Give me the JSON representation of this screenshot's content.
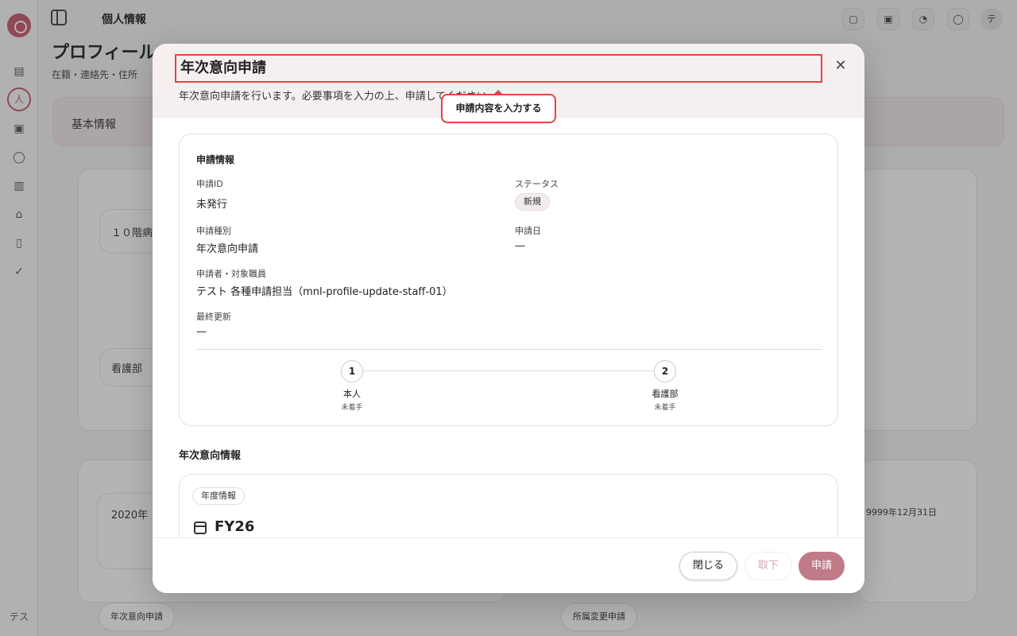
{
  "sidebar": {
    "user_initials": "テス"
  },
  "topbar": {
    "title": "個人情報",
    "avatar_initial": "テ"
  },
  "page": {
    "title": "プロフィール",
    "subtitle": "在籍・連絡先・住所",
    "tab_basic": "基本情報",
    "bg_transfer_text": "１０階病",
    "bg_dept_text": "看護部",
    "bg_year_text": "2020年",
    "bg_date_text": "9999年12月31日",
    "bg_btn_year": "年次意向申請",
    "bg_btn_dept": "所属変更申請"
  },
  "modal": {
    "title": "年次意向申請",
    "description": "年次意向申請を行います。必要事項を入力の上、申請してください。",
    "tooltip": "申請内容を入力する",
    "info": {
      "heading": "申請情報",
      "id_label": "申請ID",
      "id_value": "未発行",
      "status_label": "ステータス",
      "status_value": "新規",
      "type_label": "申請種別",
      "type_value": "年次意向申請",
      "date_label": "申請日",
      "date_value": "—",
      "applicant_label": "申請者・対象職員",
      "applicant_value": "テスト 各種申請担当（mnl-profile-update-staff-01）",
      "updated_label": "最終更新",
      "updated_value": "—"
    },
    "steps": [
      {
        "num": "1",
        "name": "本人",
        "status": "未着手"
      },
      {
        "num": "2",
        "name": "看護部",
        "status": "未着手"
      }
    ],
    "section_heading": "年次意向情報",
    "year_chip": "年度情報",
    "fiscal_year": "FY26",
    "footer": {
      "close": "閉じる",
      "withdraw": "取下",
      "apply": "申請"
    }
  },
  "colors": {
    "accent": "#c07a88",
    "highlight": "#e14545"
  }
}
